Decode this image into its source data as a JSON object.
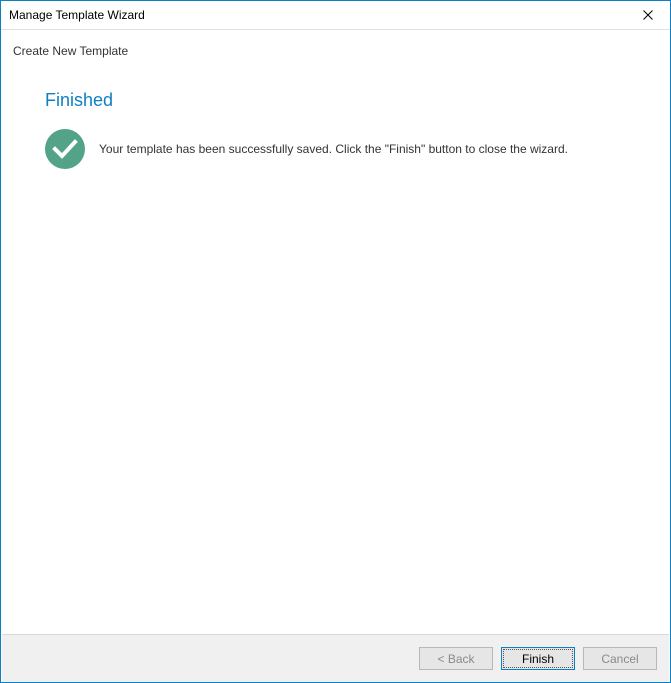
{
  "window": {
    "title": "Manage Template Wizard"
  },
  "subheader": "Create New Template",
  "content": {
    "heading": "Finished",
    "message": "Your template has been successfully saved. Click the \"Finish\" button to close the wizard."
  },
  "footer": {
    "back": "< Back",
    "finish": "Finish",
    "cancel": "Cancel"
  }
}
